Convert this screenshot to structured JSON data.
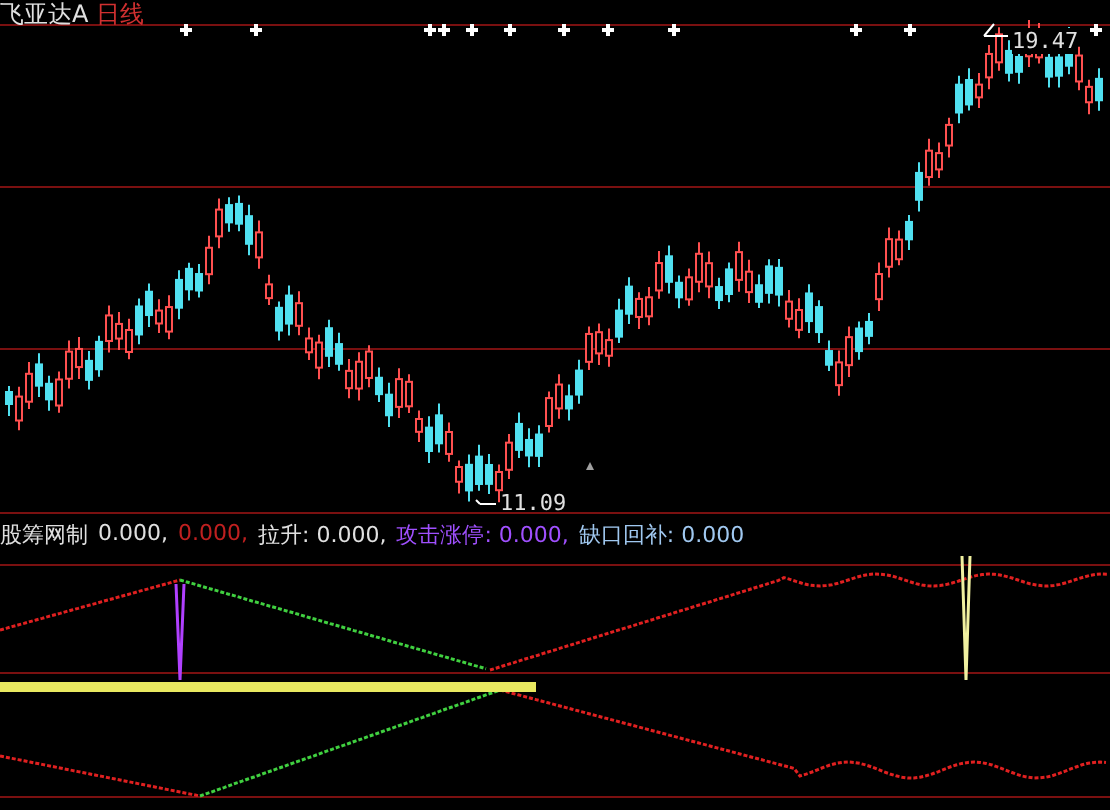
{
  "chart": {
    "stock_name": "飞亚达A",
    "period": "日线",
    "high_label": "19.47",
    "low_label": "11.09"
  },
  "indicator": {
    "name": "股筹网制",
    "values": [
      {
        "value": "0.000,",
        "color": "#e0e0e0"
      },
      {
        "value": "0.000,",
        "color": "#c02020"
      },
      {
        "label": "拉升:",
        "value": "0.000,",
        "color": "#e0e0e0"
      },
      {
        "label": "攻击涨停:",
        "value": "0.000,",
        "color": "#a050ff"
      },
      {
        "label": "缺口回补:",
        "value": "0.000",
        "color": "#a0c8f0"
      }
    ]
  }
}
